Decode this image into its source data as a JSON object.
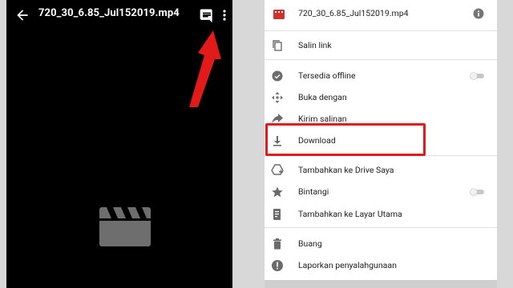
{
  "left_player": {
    "title": "720_30_6.85_Jul152019.mp4",
    "icons": {
      "back": "back-arrow-icon",
      "comment": "comment-icon",
      "more": "more-vert-icon",
      "placeholder": "clapperboard-icon"
    }
  },
  "right_menu": {
    "file_name": "720_30_6.85_Jul152019.mp4",
    "header_icons": {
      "file": "video-file-icon",
      "info": "info-icon"
    },
    "items": [
      {
        "label": "Salin link",
        "icon": "copy-icon"
      },
      {
        "label": "Tersedia offline",
        "icon": "offline-icon",
        "toggle": false
      },
      {
        "label": "Buka dengan",
        "icon": "open-with-icon"
      },
      {
        "label": "Kirim salinan",
        "icon": "share-icon"
      },
      {
        "label": "Download",
        "icon": "download-icon"
      },
      {
        "label": "Tambahkan ke Drive Saya",
        "icon": "add-to-drive-icon"
      },
      {
        "label": "Bintangi",
        "icon": "star-icon",
        "toggle": false
      },
      {
        "label": "Tambahkan ke Layar Utama",
        "icon": "home-screen-icon"
      },
      {
        "label": "Buang",
        "icon": "trash-icon"
      },
      {
        "label": "Laporkan penyalahgunaan",
        "icon": "report-icon"
      }
    ]
  },
  "colors": {
    "annotation_red": "#e21a1a",
    "video_icon_red": "#d32f2f",
    "player_bg": "#000000",
    "menu_bg": "#ffffff"
  }
}
